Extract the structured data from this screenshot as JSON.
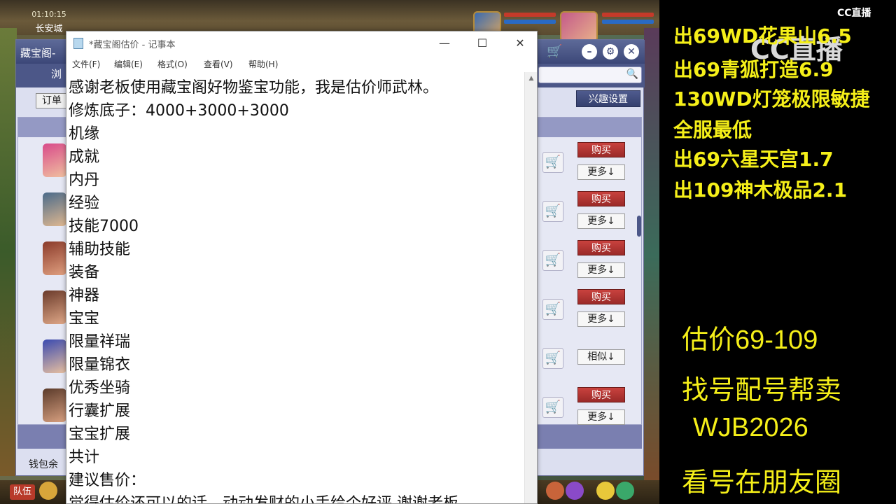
{
  "game": {
    "clock": "01:10:15",
    "city": "长安城",
    "team_button": "队伍"
  },
  "shop": {
    "title": "藏宝阁-",
    "browse_label": "浏",
    "order_button": "订单",
    "interest_button": "兴趣设置",
    "wallet_label": "钱包余",
    "rows": [
      {
        "cart": "🛒",
        "primary": "购买",
        "secondary": "更多↓"
      },
      {
        "cart": "🛒",
        "primary": "购买",
        "secondary": "更多↓"
      },
      {
        "cart": "🛒",
        "primary": "购买",
        "secondary": "更多↓"
      },
      {
        "cart": "🛒",
        "primary": "购买",
        "secondary": "更多↓"
      },
      {
        "cart": "🛒",
        "primary": "",
        "secondary": "相似↓"
      },
      {
        "cart": "🛒",
        "primary": "购买",
        "secondary": "更多↓"
      }
    ]
  },
  "notepad": {
    "title": "*藏宝阁估价 - 记事本",
    "menus": [
      "文件(F)",
      "编辑(E)",
      "格式(O)",
      "查看(V)",
      "帮助(H)"
    ],
    "lines": [
      "感谢老板使用藏宝阁好物鉴宝功能，我是估价师武林。",
      "修炼底子：4000+3000+3000",
      "机缘",
      "成就",
      "内丹",
      "经验",
      "技能7000",
      "辅助技能",
      "装备",
      "神器",
      "宝宝",
      "限量祥瑞",
      "限量锦衣",
      "优秀坐骑",
      "行囊扩展",
      "宝宝扩展",
      "共计",
      "建议售价：",
      "觉得估价还可以的话，动动发财的小手给个好评 谢谢老板"
    ]
  },
  "overlay": {
    "logo_small": "CC直播",
    "logo_big": "CC直播",
    "promo_lines": [
      "出69WD花果山6.5",
      "出69青狐打造6.9",
      "130WD灯笼极限敏捷",
      "全服最低",
      "出69六星天宫1.7",
      "出109神木极品2.1"
    ],
    "big_lines": [
      "估价69-109",
      "找号配号帮卖",
      "WJB2026",
      "看号在朋友圈"
    ]
  },
  "colors": {
    "promo_yellow": "#f5ef19",
    "shop_header": "#4c5788",
    "buy_red": "#b83632"
  }
}
